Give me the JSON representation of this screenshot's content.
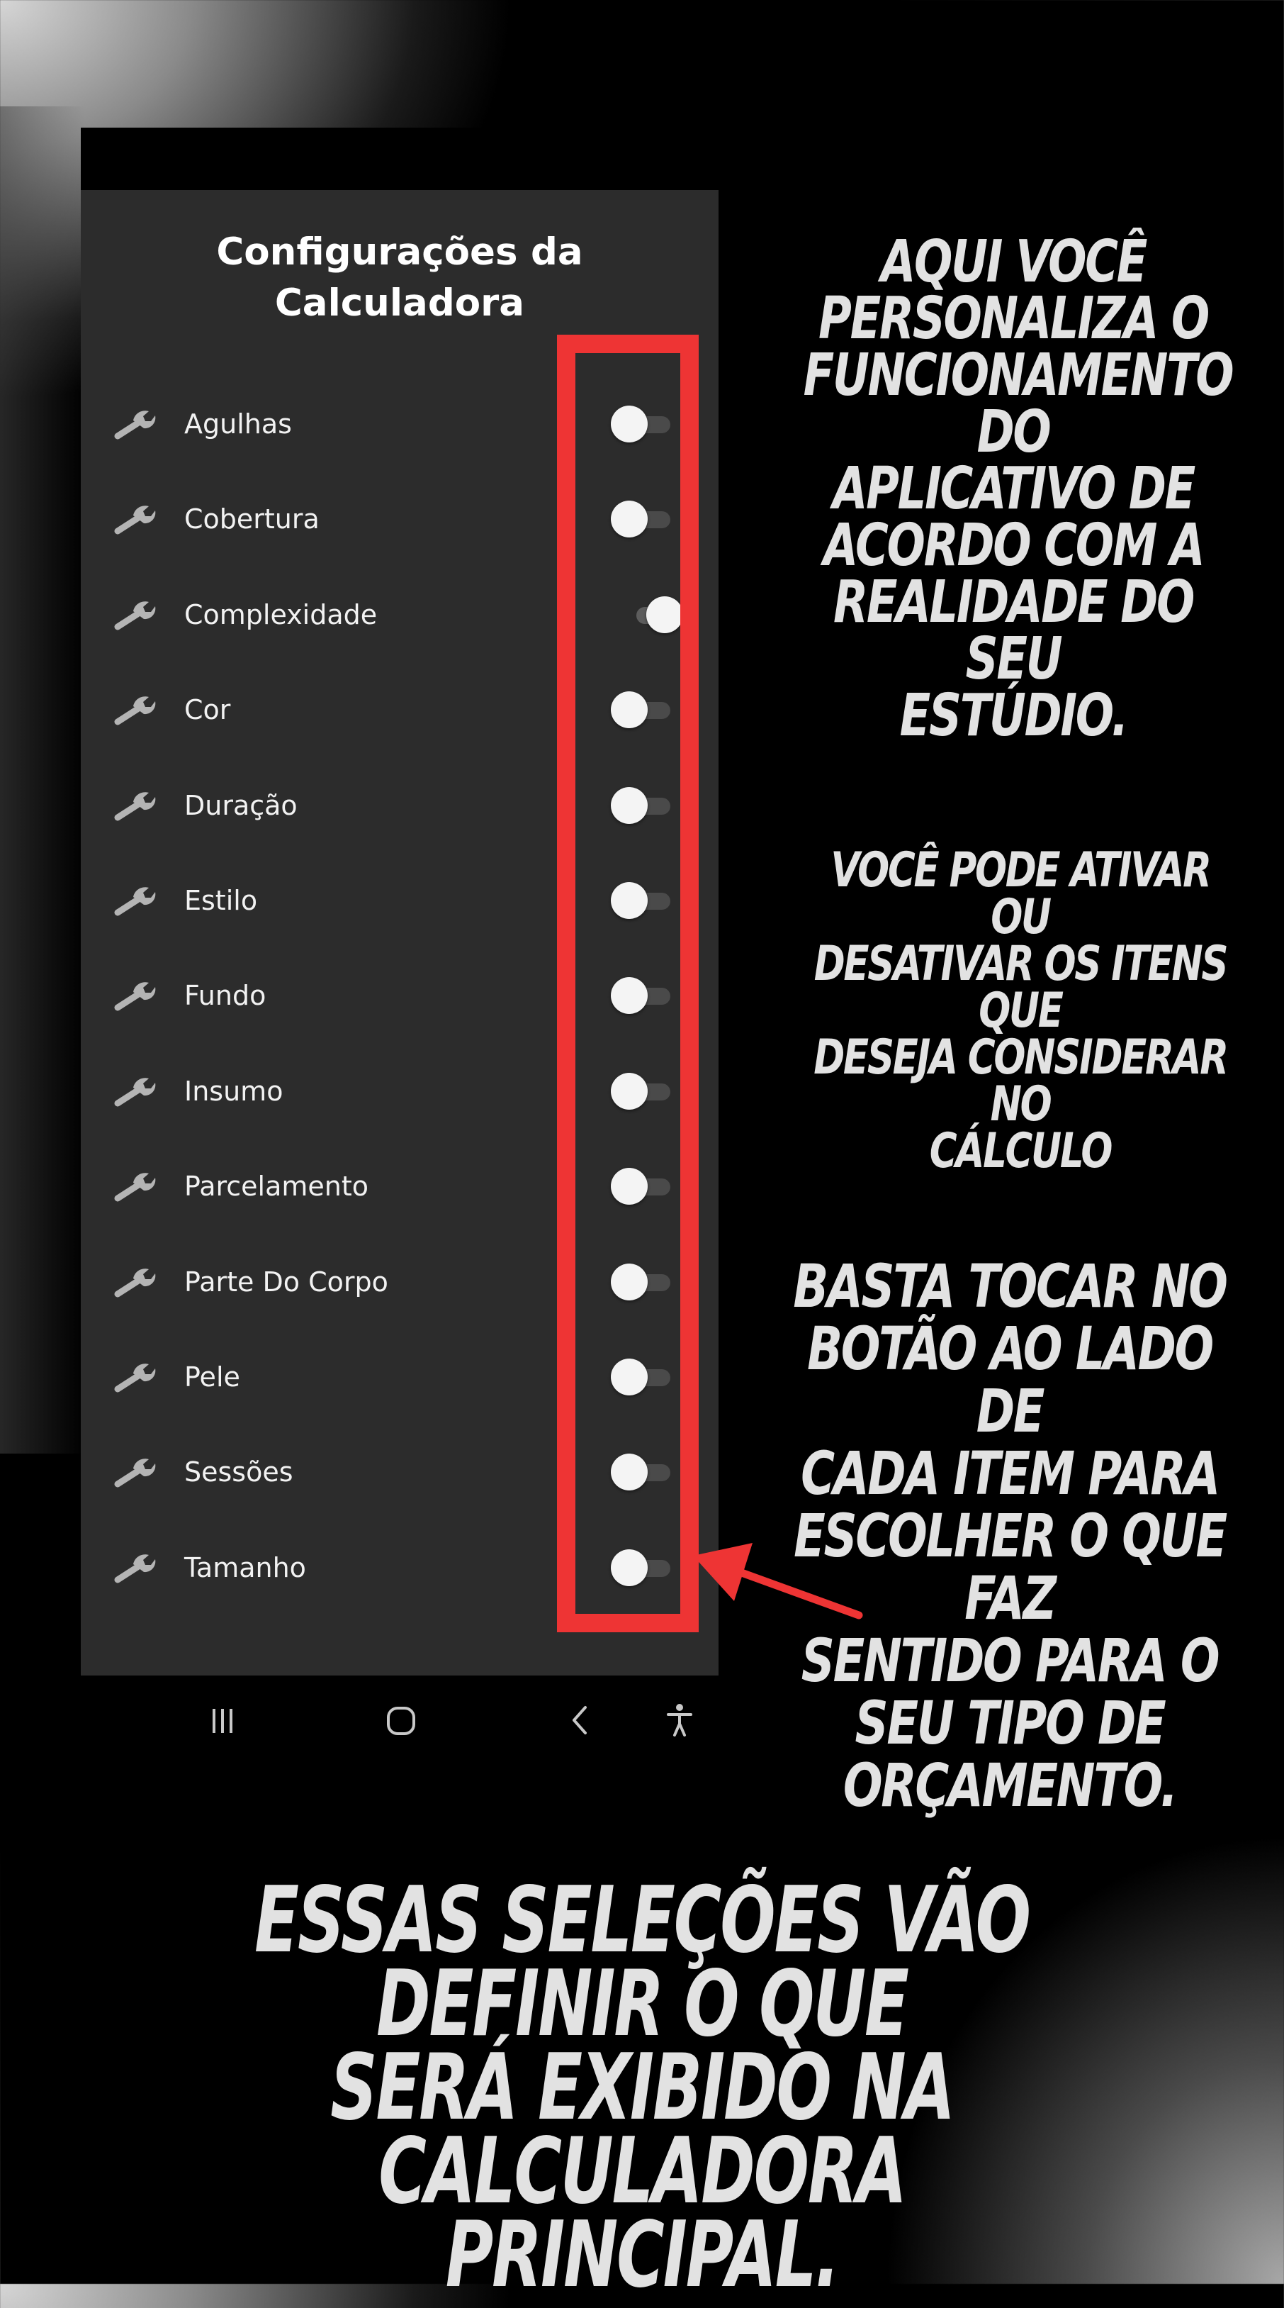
{
  "screen": {
    "title_line1": "Configurações da",
    "title_line2": "Calculadora"
  },
  "settings": [
    {
      "label": "Agulhas",
      "enabled": false
    },
    {
      "label": "Cobertura",
      "enabled": false
    },
    {
      "label": "Complexidade",
      "enabled": true
    },
    {
      "label": "Cor",
      "enabled": false
    },
    {
      "label": "Duração",
      "enabled": false
    },
    {
      "label": "Estilo",
      "enabled": false
    },
    {
      "label": "Fundo",
      "enabled": false
    },
    {
      "label": "Insumo",
      "enabled": false
    },
    {
      "label": "Parcelamento",
      "enabled": false
    },
    {
      "label": "Parte Do Corpo",
      "enabled": false
    },
    {
      "label": "Pele",
      "enabled": false
    },
    {
      "label": "Sessões",
      "enabled": false
    },
    {
      "label": "Tamanho",
      "enabled": false
    }
  ],
  "icons": {
    "row": "wrench-icon",
    "nav": [
      "recent-apps-icon",
      "home-icon",
      "back-icon",
      "accessibility-icon"
    ]
  },
  "captions": {
    "intro": [
      "AQUI VOCÊ",
      "PERSONALIZA O",
      "FUNCIONAMENTO DO",
      "APLICATIVO DE",
      "ACORDO COM A",
      "REALIDADE DO SEU",
      "ESTÚDIO."
    ],
    "toggle_info": [
      "VOCÊ PODE ATIVAR OU",
      "DESATIVAR OS ITENS QUE",
      "DESEJA CONSIDERAR NO",
      "CÁLCULO"
    ],
    "how_to": [
      "BASTA TOCAR NO",
      "BOTÃO AO LADO DE",
      "CADA ITEM PARA",
      "ESCOLHER O QUE FAZ",
      "SENTIDO PARA O",
      "SEU TIPO DE",
      "ORÇAMENTO."
    ],
    "footer": [
      "ESSAS SELEÇÕES VÃO DEFINIR O QUE",
      "SERÁ EXIBIDO NA CALCULADORA",
      "PRINCIPAL."
    ]
  },
  "colors": {
    "highlight": "#ee3434",
    "screen_bg": "#2c2c2c",
    "caption_text": "#e2e2e2"
  }
}
